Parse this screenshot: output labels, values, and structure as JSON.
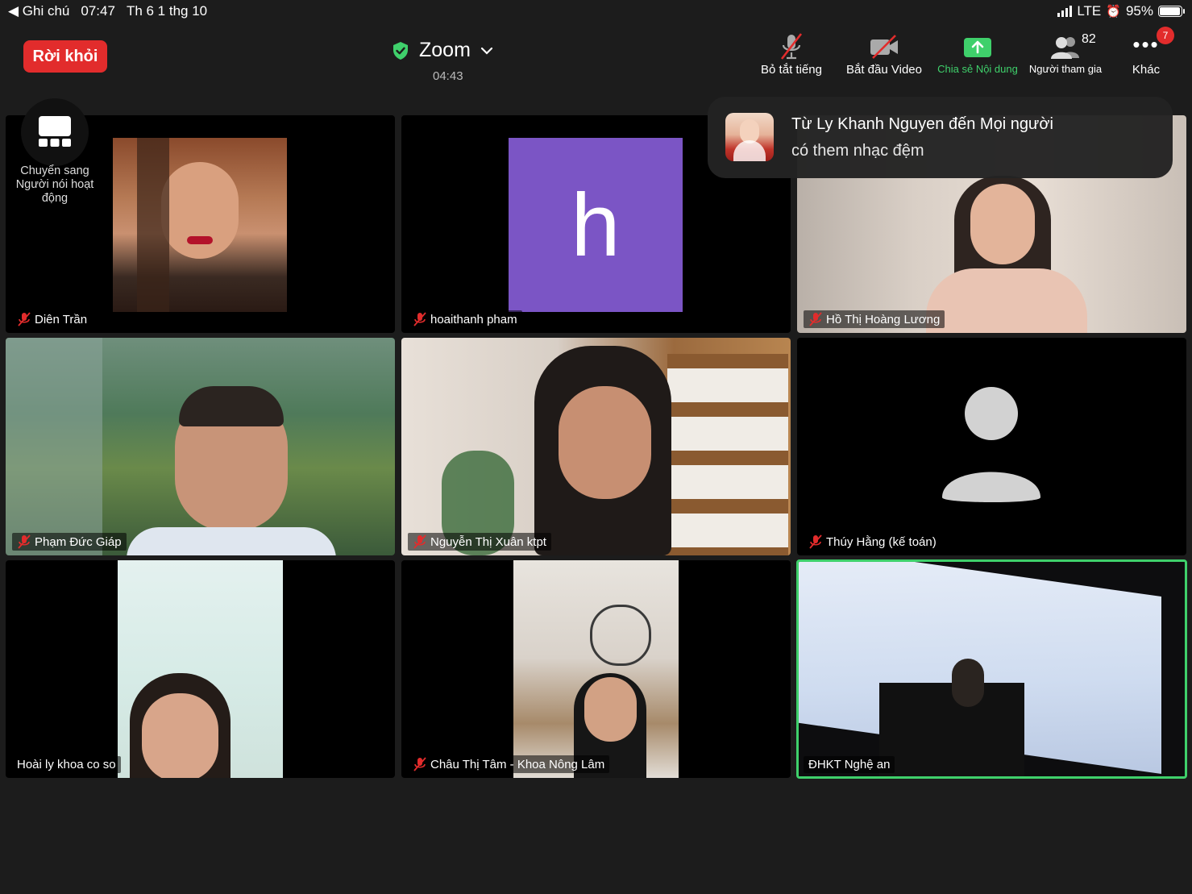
{
  "status_bar": {
    "back_app": "◀ Ghi chú",
    "time": "07:47",
    "date": "Th 6 1 thg 10",
    "network": "LTE",
    "battery": "95%",
    "battery_level": 0.95
  },
  "header": {
    "leave_label": "Rời khỏi",
    "meeting_title": "Zoom",
    "elapsed": "04:43"
  },
  "toolbar": {
    "mute_label": "Bỏ tắt tiếng",
    "video_label": "Bắt đầu Video",
    "share_label": "Chia sẻ Nội dung",
    "participants_label": "Người tham gia",
    "participants_count": "82",
    "more_label": "Khác",
    "more_badge": "7"
  },
  "layout_switch": {
    "label": "Chuyển sang Người nói hoạt động"
  },
  "toast": {
    "from": "Từ Ly Khanh Nguyen đến Mọi người",
    "message": "có them nhạc đệm"
  },
  "participants": [
    {
      "name": "Diên Trần",
      "muted": true
    },
    {
      "name": "hoaithanh pham",
      "muted": true,
      "initial": "h",
      "avatar_color": "#7b55c5"
    },
    {
      "name": "Hồ Thị Hoàng Lương",
      "muted": true
    },
    {
      "name": "Phạm Đức Giáp",
      "muted": true
    },
    {
      "name": "Nguyễn Thị Xuân ktpt",
      "muted": true
    },
    {
      "name": "Thúy Hằng (kế toán)",
      "muted": true
    },
    {
      "name": "Hoài ly khoa co so",
      "muted": false
    },
    {
      "name": "Châu Thị Tâm - Khoa Nông Lâm",
      "muted": true
    },
    {
      "name": "ĐHKT Nghệ an",
      "muted": false,
      "active_speaker": true
    }
  ],
  "colors": {
    "leave": "#e22c2c",
    "share": "#3fd06b",
    "active_border": "#3fd06b"
  }
}
